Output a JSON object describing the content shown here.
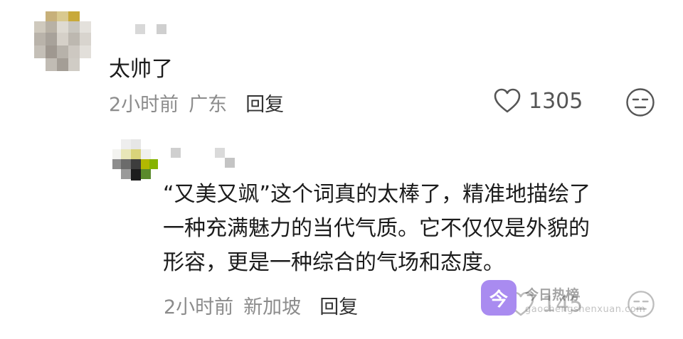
{
  "comment": {
    "text": "太帅了",
    "time": "2小时前",
    "location": "广东",
    "reply_label": "回复",
    "like_count": "1305"
  },
  "reply": {
    "lines": [
      "“又美又飒”这个词真的太棒了，精准地描绘了",
      "一种充满魅力的当代气质。它不仅仅是外貌的",
      "形容，更是一种综合的气场和态度。"
    ],
    "time": "2小时前",
    "location": "新加坡",
    "reply_label": "回复",
    "like_count": "145"
  },
  "watermark": {
    "icon_char": "今",
    "title": "今日热榜",
    "url": "gaochengshenxuan.com"
  },
  "colors": {
    "text": "#1c1c1c",
    "meta": "#8c8c8c",
    "watermark_accent": "#a98bf0"
  },
  "icons": [
    "heart-outline-icon",
    "dislike-face-icon"
  ]
}
